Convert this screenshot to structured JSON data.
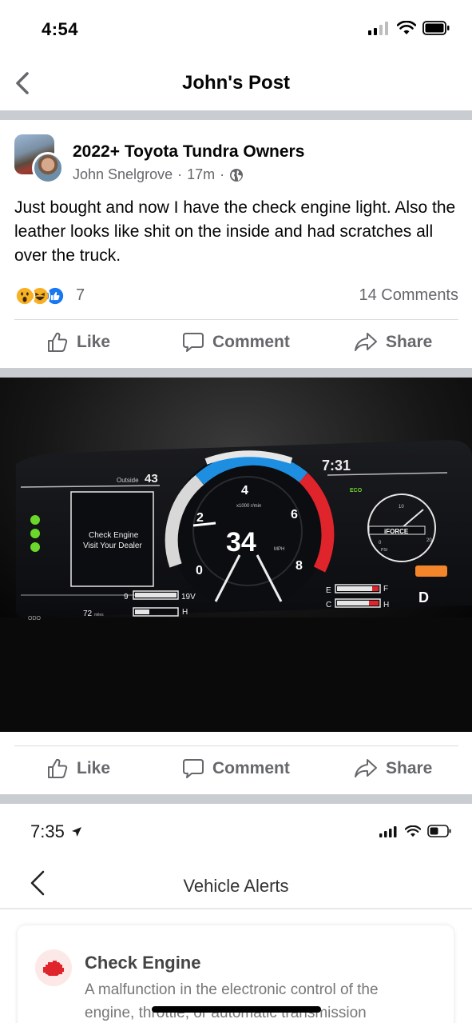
{
  "status_bar": {
    "time": "4:54"
  },
  "nav": {
    "title": "John's Post"
  },
  "post": {
    "group_name": "2022+ Toyota Tundra Owners",
    "author": "John Snelgrove",
    "time_ago": "17m",
    "separator": "·",
    "text": "Just bought and now I have the check engine light. Also the leather looks like shit on the inside and had scratches all over the truck.",
    "reaction_count": "7",
    "comments_count": "14 Comments"
  },
  "actions": {
    "like": "Like",
    "comment": "Comment",
    "share": "Share"
  },
  "dashboard_photo": {
    "clock": "7:31",
    "outside_label": "Outside",
    "outside_temp": "43",
    "eco_label": "ECO",
    "check_engine_line1": "Check Engine",
    "check_engine_line2": "Visit Your Dealer",
    "speed": "34",
    "speed_unit": "MPH",
    "rpm_label": "x1000 r/min",
    "tach_marks": [
      "0",
      "2",
      "4",
      "6",
      "8"
    ],
    "tank_small": "9",
    "range": "72",
    "range_unit": "miles",
    "voltage": "19V",
    "h_label": "H",
    "odo_label": "ODO",
    "fuel_e": "E",
    "fuel_f": "F",
    "temp_c": "C",
    "temp_h": "H",
    "gear": "D",
    "iforce_label": "iFORCE",
    "boost_label": "PSI",
    "boost_max": "20",
    "boost_mid": "10",
    "boost_zero": "0",
    "colors": {
      "tach_blue": "#1e8fe0",
      "tach_red": "#e0242b",
      "warning_green": "#6bd72a",
      "warning_amber": "#f3862a"
    }
  },
  "embedded_screenshot": {
    "time": "7:35",
    "title": "Vehicle Alerts",
    "alert_title": "Check Engine",
    "alert_desc_line1": "A malfunction in the electronic control of the",
    "alert_desc_line2": "engine, throttle, or automatic transmission"
  },
  "icons": {
    "back": "chevron-left-icon",
    "globe": "globe-icon",
    "like": "thumbs-up-icon",
    "comment": "speech-bubble-icon",
    "share": "share-arrow-icon",
    "signal": "cellular-signal-icon",
    "wifi": "wifi-icon",
    "battery": "battery-icon",
    "location": "location-arrow-icon",
    "engine": "engine-icon"
  }
}
